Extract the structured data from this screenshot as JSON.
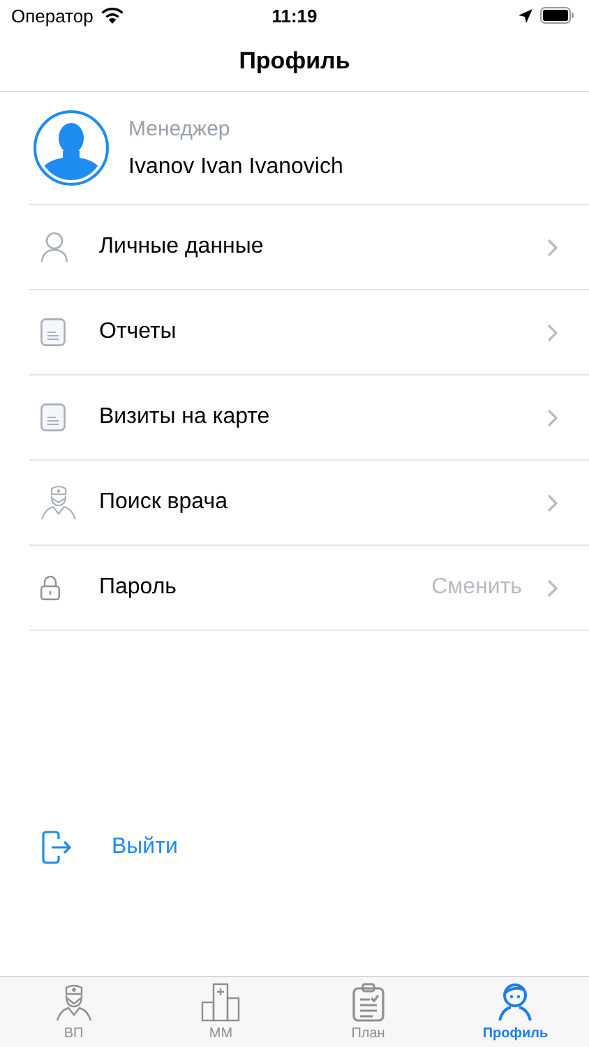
{
  "status_bar": {
    "carrier": "Оператор",
    "time": "11:19"
  },
  "nav_bar": {
    "title": "Профиль"
  },
  "profile": {
    "role": "Менеджер",
    "name": "Ivanov Ivan Ivanovich"
  },
  "menu": [
    {
      "kind": "person",
      "label": "Личные данные"
    },
    {
      "kind": "document",
      "label": "Отчеты"
    },
    {
      "kind": "document",
      "label": "Визиты на карте"
    },
    {
      "kind": "doctor",
      "label": "Поиск врача"
    },
    {
      "kind": "lock",
      "label": "Пароль",
      "value": "Сменить"
    }
  ],
  "logout": {
    "label": "Выйти"
  },
  "tabs": [
    {
      "kind": "doctor",
      "label": "ВП",
      "selected": false
    },
    {
      "kind": "hospital",
      "label": "ММ",
      "selected": false
    },
    {
      "kind": "clipboard",
      "label": "План",
      "selected": false
    },
    {
      "kind": "profile",
      "label": "Профиль",
      "selected": true
    }
  ]
}
